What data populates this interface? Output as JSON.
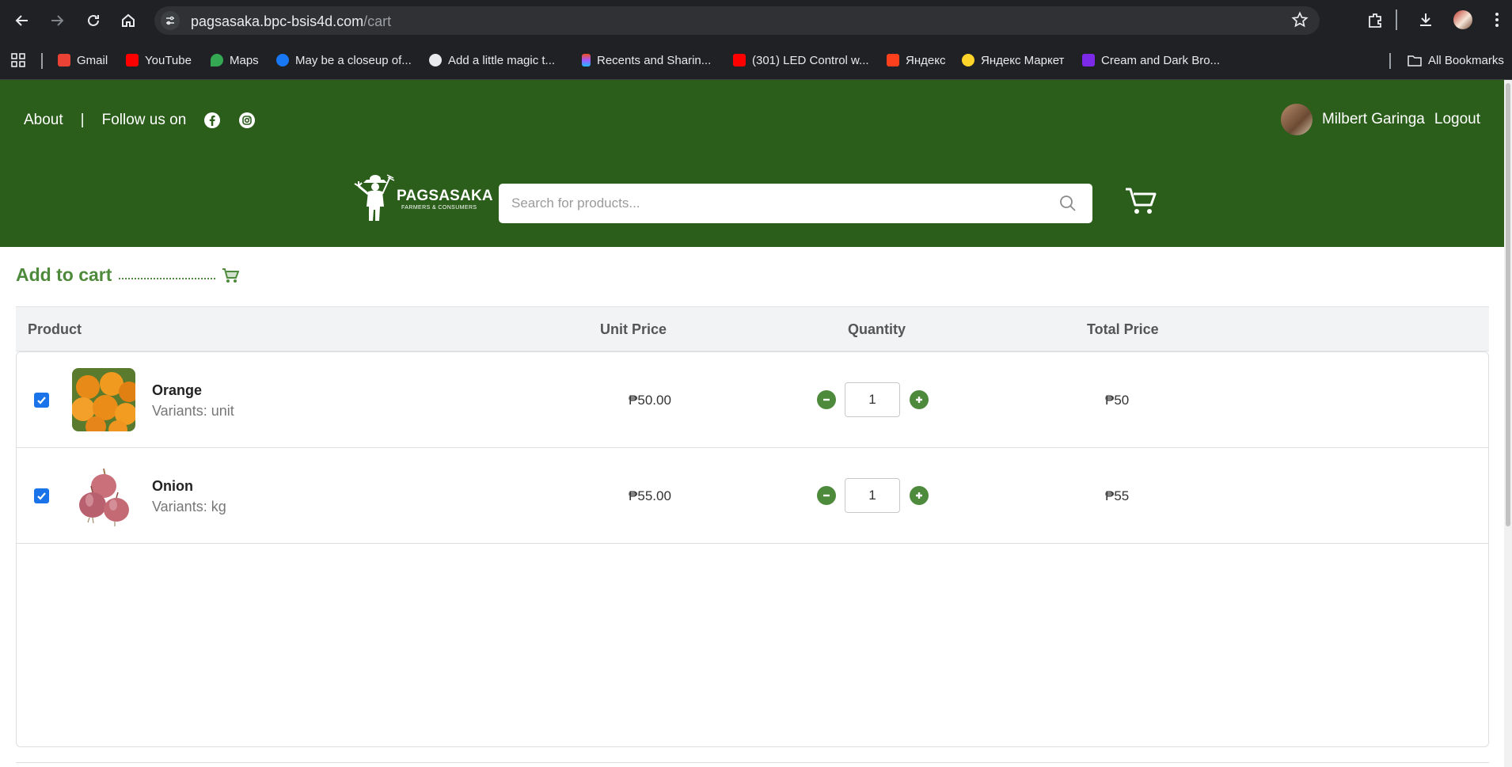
{
  "browser": {
    "url_host": "pagsasaka.bpc-bsis4d.com",
    "url_path": "/cart",
    "bookmarks": [
      {
        "label": "Gmail",
        "color": "#ea4335"
      },
      {
        "label": "YouTube",
        "color": "#ff0000"
      },
      {
        "label": "Maps",
        "color": "#34a853"
      },
      {
        "label": "May be a closeup of...",
        "color": "#1877f2"
      },
      {
        "label": "Add a little magic t...",
        "color": "#e8eaed"
      },
      {
        "label": "Recents and Sharin...",
        "color": "#a259ff"
      },
      {
        "label": "(301) LED Control w...",
        "color": "#ff0000"
      },
      {
        "label": "Яндекс",
        "color": "#fc3f1d"
      },
      {
        "label": "Яндекс Маркет",
        "color": "#fed42b"
      },
      {
        "label": "Cream and Dark Bro...",
        "color": "#7d2ae8"
      }
    ],
    "all_bookmarks": "All Bookmarks"
  },
  "header": {
    "about": "About",
    "separator": "|",
    "follow": "Follow us on",
    "user_name": "Milbert Garinga",
    "logout": "Logout",
    "logo_brand": "PAGSASAKA",
    "logo_tagline": "FARMERS & CONSUMERS",
    "search_placeholder": "Search for products...",
    "brand_color": "#2a5e1a",
    "accent_color": "#4e8a3c"
  },
  "cart": {
    "title": "Add to cart",
    "columns": {
      "product": "Product",
      "unit_price": "Unit Price",
      "quantity": "Quantity",
      "total_price": "Total Price"
    },
    "items": [
      {
        "name": "Orange",
        "variant": "Variants: unit",
        "unit_price": "₱50.00",
        "quantity": "1",
        "total": "₱50",
        "checked": true
      },
      {
        "name": "Onion",
        "variant": "Variants: kg",
        "unit_price": "₱55.00",
        "quantity": "1",
        "total": "₱55",
        "checked": true
      }
    ]
  }
}
